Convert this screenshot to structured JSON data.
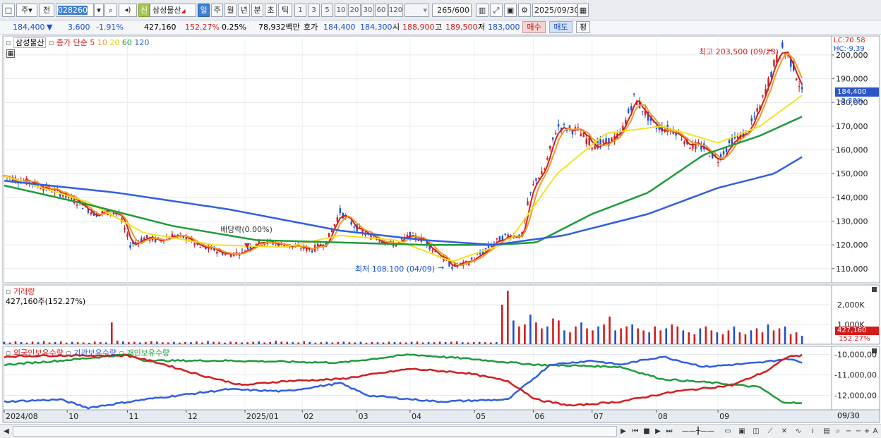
{
  "toolbar": {
    "menu_icon": "□",
    "dropdown1": "주",
    "dropdown2": "전",
    "code": "028260",
    "search_icon": "🔍",
    "sound_icon": "◂)",
    "new_badge": "신",
    "stock_name": "삼성물산",
    "periods": [
      "일",
      "주",
      "월",
      "년",
      "분",
      "초",
      "틱"
    ],
    "intervals": [
      "1",
      "3",
      "5",
      "10",
      "20",
      "30",
      "60",
      "120"
    ],
    "count": "265",
    "count_total": "/600",
    "date": "2025/09/30"
  },
  "info": {
    "price": "184,400",
    "change_arrow": "▼",
    "change": "3,600",
    "change_pct": "-1.91%",
    "volume": "427,160",
    "volume_pct": "152.27%",
    "turnover": "0.25%",
    "amount": "78,932백만",
    "bid_label": "호가",
    "bid1": "184,400",
    "bid2": "184,300",
    "open_label": "시",
    "open": "188,900",
    "high_label": "고",
    "high": "189,500",
    "low_label": "저",
    "low": "183,000",
    "buy_button": "매수",
    "sell_button": "매도",
    "eval_button": "평"
  },
  "price_panel": {
    "name_tag": "삼성물산",
    "legend_title": "종가 단순",
    "ma_periods": [
      "5",
      "10",
      "20",
      "60",
      "120"
    ],
    "ma_colors": [
      "#d21d1d",
      "#f29b25",
      "#f2e225",
      "#1f9b3a",
      "#2f5fe0"
    ],
    "lc_label": "LC:70.58",
    "hc_label": "HC:-9.39",
    "current_price_tag": "184,400",
    "current_pct_tag": "-2.38%",
    "high_annotation": "최고 203,500 (09/23)",
    "low_annotation": "최저 108,100 (04/09)",
    "dividend_annotation": "배당락(0.00%)",
    "y_ticks": [
      "200,000",
      "190,000",
      "180,000",
      "170,000",
      "160,000",
      "150,000",
      "140,000",
      "130,000",
      "120,000",
      "110,000"
    ]
  },
  "volume_panel": {
    "title": "거래량",
    "subtitle": "427,160주(152.27%)",
    "y_ticks": [
      "2,000K",
      "1,000K"
    ],
    "current_tag": "427,160",
    "current_pct": "152.27%"
  },
  "holdings_panel": {
    "legends": [
      "외국인보유수량",
      "기관보유수량",
      "개인보유수량"
    ],
    "colors": [
      "#d21d1d",
      "#2f5fe0",
      "#1f9b3a"
    ],
    "y_ticks": [
      "-10,000,00",
      "-11,000,00",
      "-12,000,00"
    ]
  },
  "x_axis": {
    "labels": [
      "2024/08",
      "10",
      "11",
      "12",
      "2025/01",
      "02",
      "03",
      "04",
      "05",
      "06",
      "07",
      "08",
      "09"
    ],
    "end_label": "09/30"
  },
  "chart_data": {
    "type": "candlestick",
    "ylim": [
      104000,
      208000
    ],
    "close_trend": [
      [
        0,
        149000
      ],
      [
        20,
        146000
      ],
      [
        40,
        142000
      ],
      [
        55,
        137000
      ],
      [
        65,
        133000
      ],
      [
        75,
        134000
      ],
      [
        82,
        133000
      ],
      [
        90,
        120000
      ],
      [
        100,
        123000
      ],
      [
        110,
        122000
      ],
      [
        120,
        124000
      ],
      [
        130,
        123000
      ],
      [
        140,
        119000
      ],
      [
        150,
        118000
      ],
      [
        160,
        116000
      ],
      [
        170,
        117000
      ],
      [
        180,
        121000
      ],
      [
        190,
        121000
      ],
      [
        200,
        120000
      ],
      [
        210,
        119000
      ],
      [
        220,
        118000
      ],
      [
        230,
        121000
      ],
      [
        240,
        134000
      ],
      [
        250,
        128000
      ],
      [
        260,
        124000
      ],
      [
        270,
        122000
      ],
      [
        280,
        120000
      ],
      [
        290,
        124000
      ],
      [
        300,
        122000
      ],
      [
        310,
        116000
      ],
      [
        320,
        111000
      ],
      [
        330,
        112000
      ],
      [
        340,
        116000
      ],
      [
        350,
        121000
      ],
      [
        360,
        124000
      ],
      [
        370,
        124000
      ],
      [
        375,
        140000
      ],
      [
        380,
        148000
      ],
      [
        385,
        150000
      ],
      [
        395,
        170000
      ],
      [
        410,
        168000
      ],
      [
        420,
        162000
      ],
      [
        430,
        163000
      ],
      [
        440,
        166000
      ],
      [
        450,
        182000
      ],
      [
        455,
        178000
      ],
      [
        465,
        170000
      ],
      [
        480,
        168000
      ],
      [
        490,
        162000
      ],
      [
        500,
        161000
      ],
      [
        510,
        156000
      ],
      [
        520,
        164000
      ],
      [
        530,
        167000
      ],
      [
        540,
        178000
      ],
      [
        550,
        196000
      ],
      [
        556,
        203000
      ],
      [
        564,
        195000
      ],
      [
        570,
        184400
      ]
    ],
    "ma_series": [
      {
        "name": "60",
        "values": [
          [
            0,
            145000
          ],
          [
            60,
            137000
          ],
          [
            120,
            128000
          ],
          [
            180,
            122000
          ],
          [
            240,
            121000
          ],
          [
            300,
            120000
          ],
          [
            350,
            120000
          ],
          [
            380,
            121000
          ],
          [
            420,
            133000
          ],
          [
            460,
            142000
          ],
          [
            500,
            158000
          ],
          [
            540,
            166000
          ],
          [
            570,
            174000
          ]
        ]
      },
      {
        "name": "120",
        "values": [
          [
            0,
            147000
          ],
          [
            80,
            142000
          ],
          [
            160,
            135000
          ],
          [
            240,
            126000
          ],
          [
            300,
            122000
          ],
          [
            350,
            120000
          ],
          [
            400,
            124000
          ],
          [
            460,
            133000
          ],
          [
            510,
            144000
          ],
          [
            550,
            150000
          ],
          [
            570,
            157000
          ]
        ]
      },
      {
        "name": "20",
        "values": [
          [
            0,
            149000
          ],
          [
            60,
            138000
          ],
          [
            100,
            125000
          ],
          [
            150,
            120000
          ],
          [
            200,
            119000
          ],
          [
            240,
            124000
          ],
          [
            280,
            122000
          ],
          [
            320,
            113000
          ],
          [
            360,
            121000
          ],
          [
            395,
            150000
          ],
          [
            430,
            167000
          ],
          [
            470,
            170000
          ],
          [
            510,
            163000
          ],
          [
            540,
            170000
          ],
          [
            570,
            183000
          ]
        ]
      }
    ],
    "volume_bars_k": [
      120,
      90,
      150,
      110,
      80,
      130,
      100,
      160,
      90,
      110,
      140,
      80,
      120,
      100,
      90,
      70,
      130,
      110,
      90,
      1100,
      180,
      140,
      100,
      120,
      90,
      110,
      150,
      130,
      100,
      90,
      120,
      80,
      110,
      100,
      140,
      90,
      160,
      120,
      100,
      80,
      130,
      110,
      90,
      100,
      120,
      140,
      90,
      110,
      170,
      130,
      120,
      100,
      90,
      150,
      110,
      80,
      100,
      120,
      90,
      110,
      130,
      100,
      90,
      120,
      80,
      110,
      100,
      90,
      120,
      110,
      100,
      90,
      120,
      130,
      90,
      110,
      100,
      130,
      110,
      120,
      140,
      100,
      90,
      110,
      120,
      100,
      90,
      110,
      2000,
      2700,
      1200,
      900,
      1000,
      1500,
      1100,
      800,
      900,
      1300,
      1200,
      700,
      600,
      900,
      1100,
      800,
      700,
      900,
      1000,
      1400,
      700,
      800,
      900,
      1000,
      800,
      700,
      600,
      900,
      700,
      800,
      1000,
      900,
      700,
      600,
      500,
      800,
      900,
      700,
      600,
      500,
      700,
      900,
      600,
      500,
      700,
      800,
      600,
      1000,
      700,
      800,
      900,
      500,
      600,
      427
    ]
  }
}
